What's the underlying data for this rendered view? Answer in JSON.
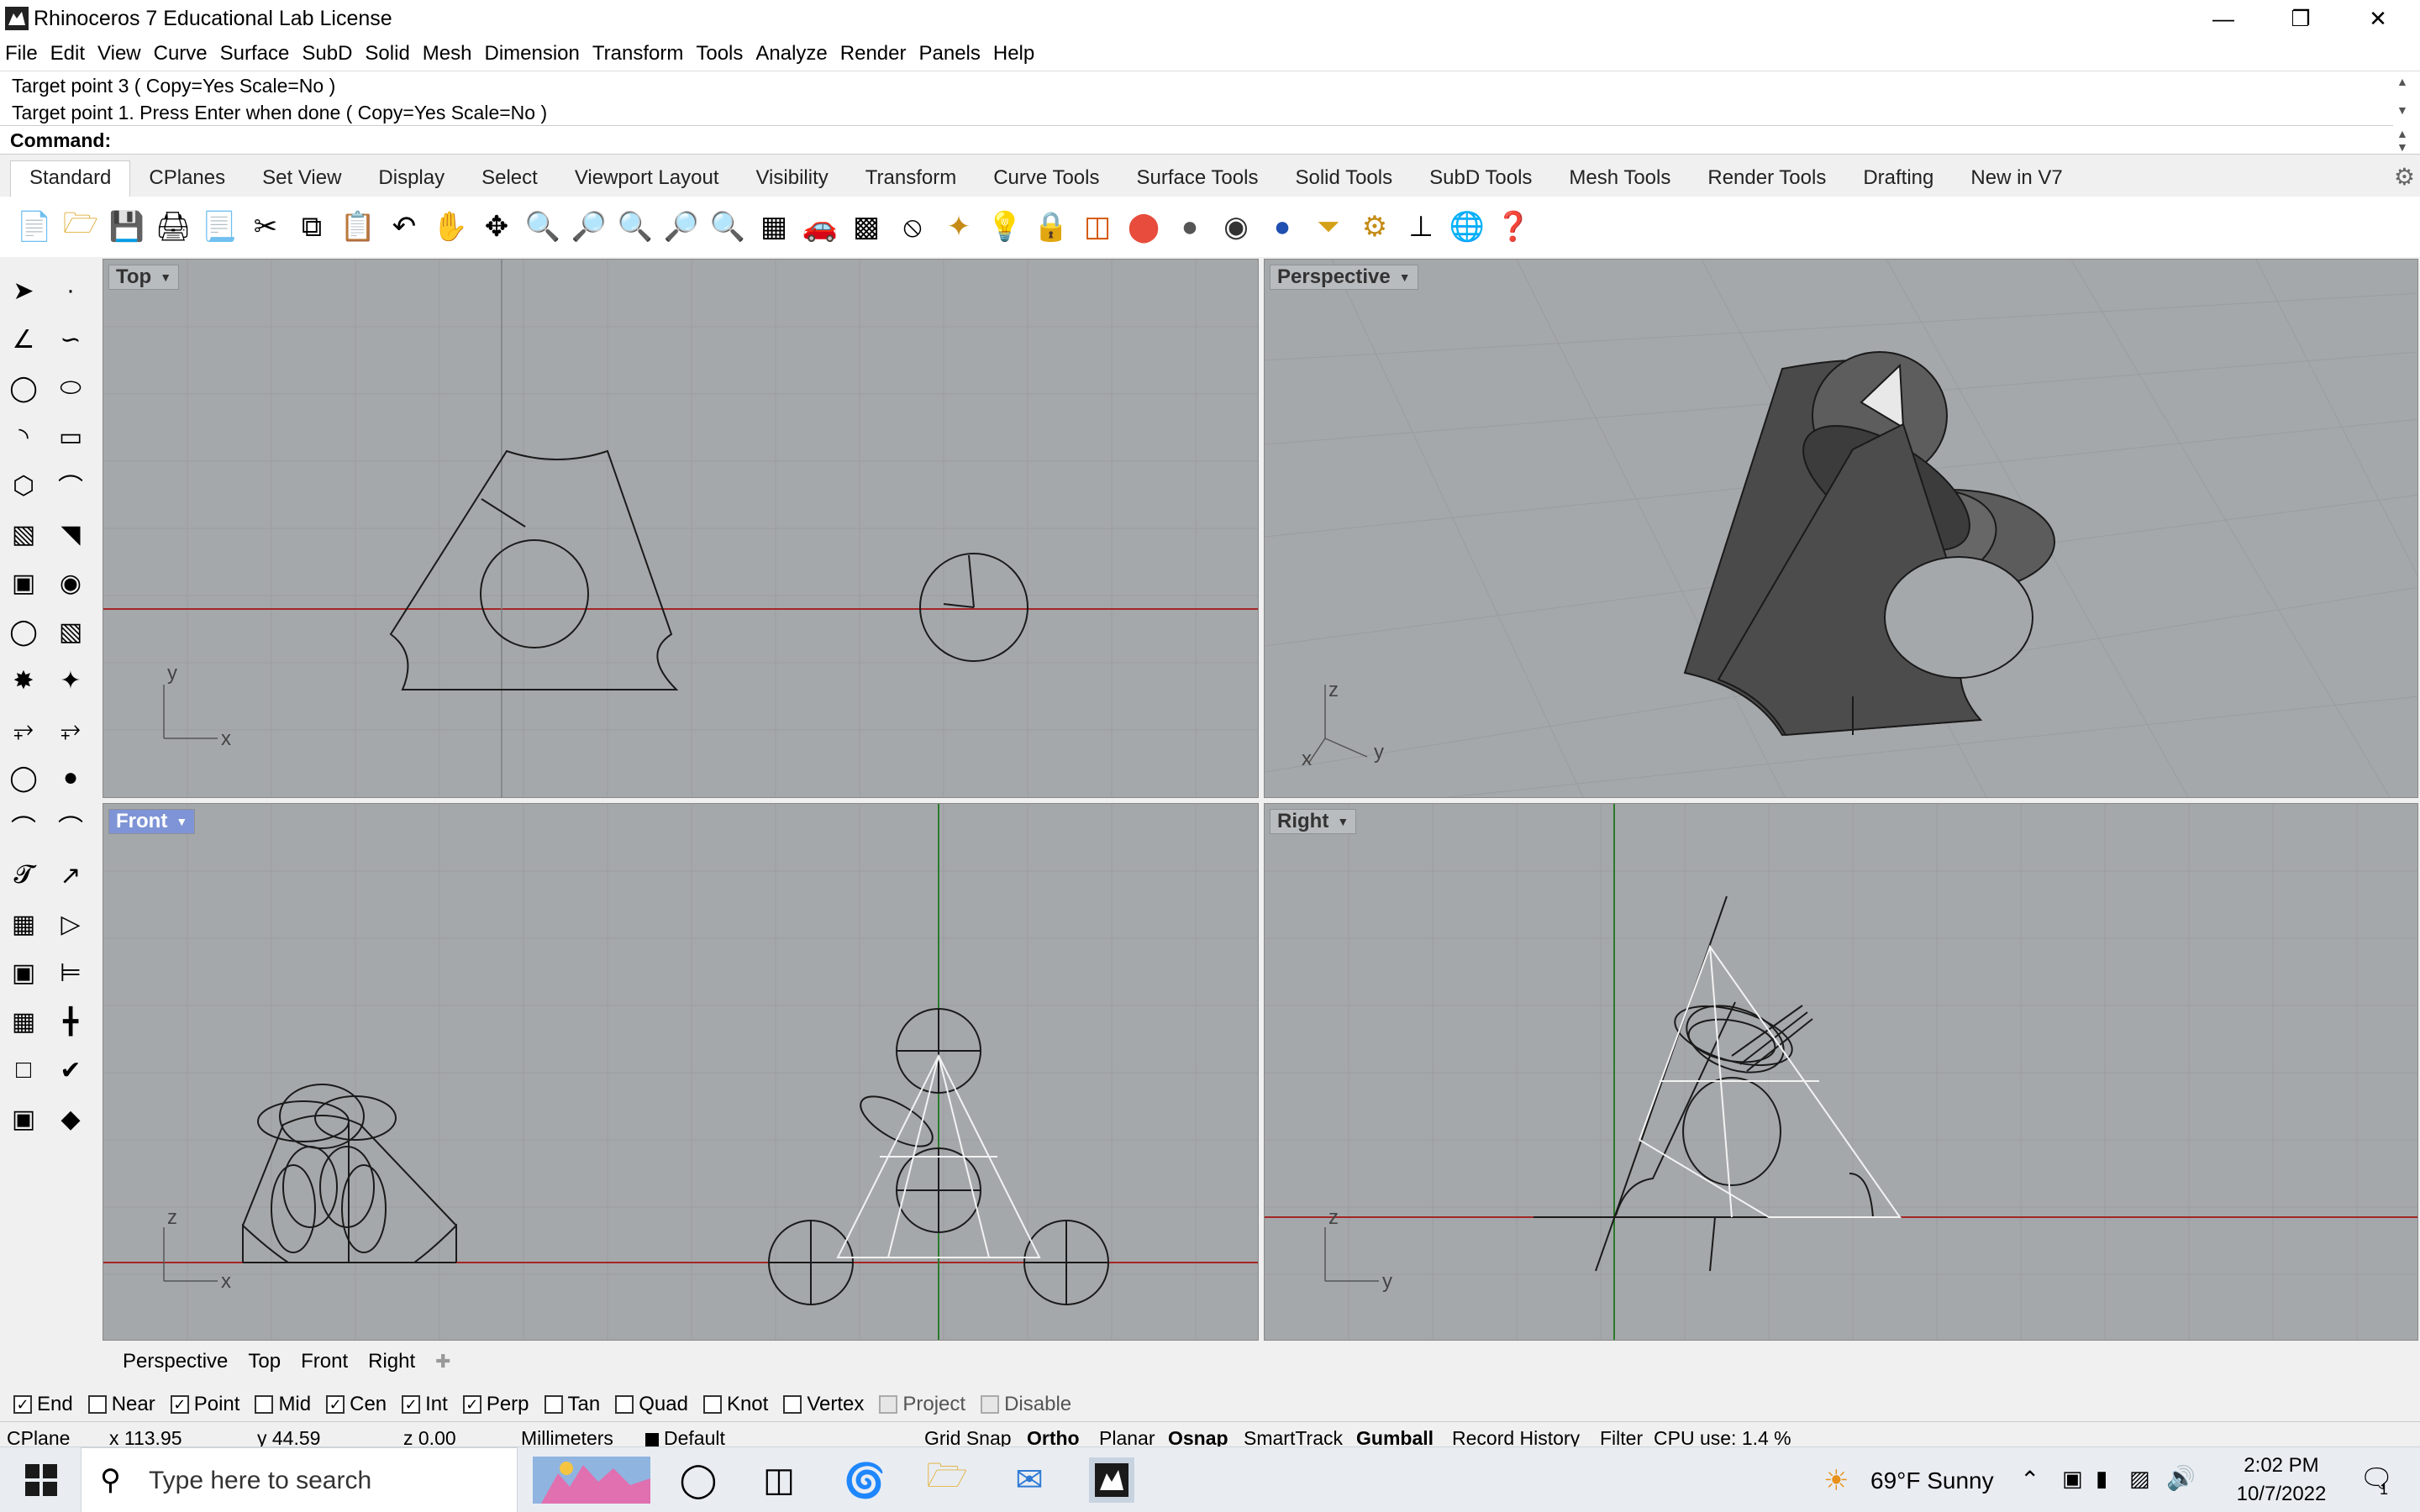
{
  "window": {
    "title": "Rhinoceros 7 Educational Lab License"
  },
  "menu": [
    "File",
    "Edit",
    "View",
    "Curve",
    "Surface",
    "SubD",
    "Solid",
    "Mesh",
    "Dimension",
    "Transform",
    "Tools",
    "Analyze",
    "Render",
    "Panels",
    "Help"
  ],
  "command": {
    "history": [
      "Target point 3 ( Copy=Yes  Scale=No )",
      "Target point 1. Press Enter when done ( Copy=Yes  Scale=No )"
    ],
    "prompt": "Command:",
    "value": ""
  },
  "toolbar_tabs": [
    "Standard",
    "CPlanes",
    "Set View",
    "Display",
    "Select",
    "Viewport Layout",
    "Visibility",
    "Transform",
    "Curve Tools",
    "Surface Tools",
    "Solid Tools",
    "SubD Tools",
    "Mesh Tools",
    "Render Tools",
    "Drafting",
    "New in V7"
  ],
  "active_tab": "Standard",
  "viewports": {
    "top": {
      "label": "Top",
      "axis_x": "x",
      "axis_y": "y"
    },
    "perspective": {
      "label": "Perspective",
      "axis_x": "x",
      "axis_y": "y",
      "axis_z": "z"
    },
    "front": {
      "label": "Front",
      "axis_x": "x",
      "axis_z": "z"
    },
    "right": {
      "label": "Right",
      "axis_y": "y",
      "axis_z": "z"
    }
  },
  "viewport_tabs": [
    "Perspective",
    "Top",
    "Front",
    "Right"
  ],
  "osnaps": [
    {
      "label": "End",
      "checked": true
    },
    {
      "label": "Near",
      "checked": false
    },
    {
      "label": "Point",
      "checked": true
    },
    {
      "label": "Mid",
      "checked": false
    },
    {
      "label": "Cen",
      "checked": true
    },
    {
      "label": "Int",
      "checked": true
    },
    {
      "label": "Perp",
      "checked": true
    },
    {
      "label": "Tan",
      "checked": false
    },
    {
      "label": "Quad",
      "checked": false
    },
    {
      "label": "Knot",
      "checked": false
    },
    {
      "label": "Vertex",
      "checked": false
    },
    {
      "label": "Project",
      "checked": false,
      "disabled": true
    },
    {
      "label": "Disable",
      "checked": false,
      "disabled": true
    }
  ],
  "status": {
    "cplane": "CPlane",
    "x": "x 113.95",
    "y": "y 44.59",
    "z": "z 0.00",
    "units": "Millimeters",
    "layer": "Default",
    "grid_snap": "Grid Snap",
    "ortho": "Ortho",
    "planar": "Planar",
    "osnap": "Osnap",
    "smarttrack": "SmartTrack",
    "gumball": "Gumball",
    "record_history": "Record History",
    "filter": "Filter",
    "cpu": "CPU use: 1.4 %"
  },
  "taskbar": {
    "search_placeholder": "Type here to search",
    "weather": "69°F  Sunny",
    "time": "2:02 PM",
    "date": "10/7/2022",
    "notifications": "1"
  }
}
